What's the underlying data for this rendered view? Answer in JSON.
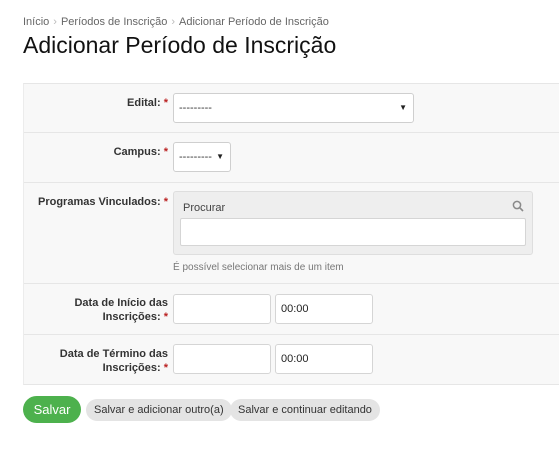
{
  "breadcrumbs": [
    "Início",
    "Períodos de Inscrição",
    "Adicionar Período de Inscrição"
  ],
  "page_title": "Adicionar Período de Inscrição",
  "fields": {
    "edital": {
      "label": "Edital:",
      "required": "*",
      "value": "---------"
    },
    "campus": {
      "label": "Campus:",
      "required": "*",
      "value": "---------"
    },
    "programas": {
      "label": "Programas Vinculados:",
      "required": "*",
      "search_placeholder": "Procurar",
      "help": "É possível selecionar mais de um item"
    },
    "inicio": {
      "label_line1": "Data de Início das",
      "label_line2": "Inscrições:",
      "required": "*",
      "date": "",
      "time": "00:00"
    },
    "termino": {
      "label_line1": "Data de Término das",
      "label_line2": "Inscrições:",
      "required": "*",
      "date": "",
      "time": "00:00"
    }
  },
  "buttons": {
    "save": "Salvar",
    "save_add": "Salvar e adicionar outro(a)",
    "save_continue": "Salvar e continuar editando"
  },
  "colors": {
    "primary": "#4db14d",
    "required": "#ba2121"
  },
  "icons": {
    "search": "search-icon",
    "dropdown": "triangle-down-icon"
  }
}
